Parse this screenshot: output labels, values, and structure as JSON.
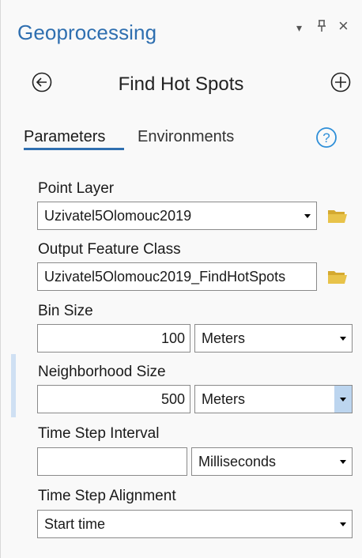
{
  "pane": {
    "title": "Geoprocessing",
    "controls": {
      "menu": "▾",
      "pin": "ᚩ",
      "close": "×"
    }
  },
  "tool": {
    "title": "Find Hot Spots",
    "back_icon": "back-circle-icon",
    "add_icon": "add-circle-icon"
  },
  "tabs": [
    {
      "label": "Parameters",
      "active": true
    },
    {
      "label": "Environments",
      "active": false
    }
  ],
  "help": {
    "icon": "question-circle-icon",
    "glyph": "?"
  },
  "params": {
    "point_layer": {
      "label": "Point Layer",
      "value": "Uzivatel5Olomouc2019"
    },
    "output_feature_class": {
      "label": "Output Feature Class",
      "value": "Uzivatel5Olomouc2019_FindHotSpots"
    },
    "bin_size": {
      "label": "Bin Size",
      "value": "100",
      "unit": "Meters"
    },
    "neighborhood_size": {
      "label": "Neighborhood Size",
      "value": "500",
      "unit": "Meters"
    },
    "time_step_interval": {
      "label": "Time Step Interval",
      "value": "",
      "unit": "Milliseconds"
    },
    "time_step_alignment": {
      "label": "Time Step Alignment",
      "value": "Start time"
    }
  },
  "colors": {
    "accent": "#2f6fb0",
    "folder": "#e8c34a",
    "selection": "#cfe0f3"
  }
}
